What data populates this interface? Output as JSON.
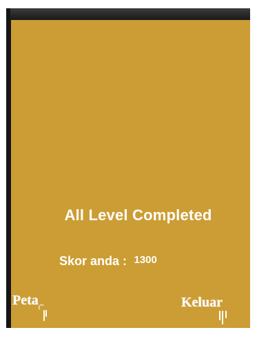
{
  "game": {
    "title": "All Level Completed",
    "score_label": "Skor anda :",
    "score_value": "1300"
  },
  "buttons": {
    "map": "Peta",
    "exit": "Keluar"
  },
  "colors": {
    "panel": "#cc9d34",
    "border": "#1a1a1a",
    "text": "#ffffff"
  }
}
